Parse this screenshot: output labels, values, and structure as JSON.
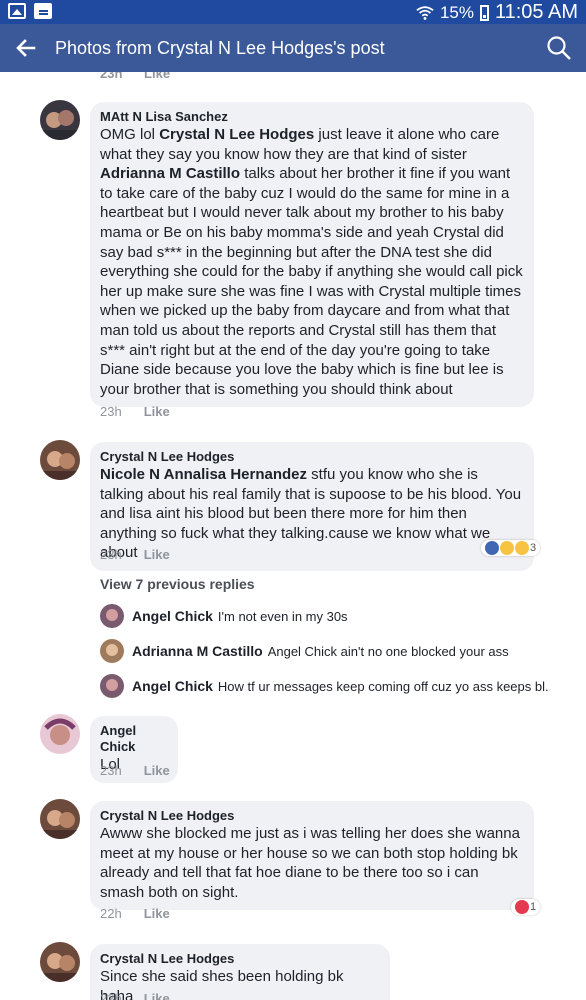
{
  "status_bar": {
    "battery": "15%",
    "time": "11:05 AM",
    "icons": [
      "image-icon",
      "message-icon",
      "wifi-icon",
      "battery-icon"
    ]
  },
  "appbar": {
    "title": "Photos from Crystal N Lee Hodges's post"
  },
  "top_partial": {
    "time": "23h",
    "like": "Like"
  },
  "comments": [
    {
      "author": "MAtt N Lisa Sanchez",
      "text_parts": [
        "OMG lol ",
        "Crystal N Lee Hodges",
        " just leave  it alone who care what they say you know how they are that kind of sister ",
        "Adrianna M Castillo",
        " talks about her  brother it fine if you want to take care of the baby cuz I would do the same for mine in a heartbeat but I would never talk about my brother to his baby mama or Be on his baby momma's side and yeah  Crystal did say bad s*** in the beginning but after the DNA test she did everything she could for the baby if anything she would call pick her up make sure she was fine I was with Crystal multiple times when we picked up the baby from daycare and from what that man told us about the reports and Crystal still has them that s*** ain't right but at the end of the day you're going to take Diane side because you love the baby which is fine but lee is your brother that is something you should think about"
      ],
      "time": "23h",
      "like": "Like"
    },
    {
      "author": "Crystal N Lee Hodges",
      "text_parts": [
        "Nicole N Annalisa Hernandez",
        " stfu you know who she is talking about his real family that is supoose to be his blood. You and lisa aint his blood but been there more for him then anything so fuck what they talking.cause we know what we about"
      ],
      "time": "23h",
      "like": "Like",
      "reactions": {
        "count": "3",
        "icons": [
          "like-icon",
          "haha-icon",
          "wow-icon"
        ]
      },
      "view_replies": "View 7 previous replies",
      "replies": [
        {
          "author": "Angel Chick",
          "text": "I'm not even in my 30s"
        },
        {
          "author": "Adrianna M Castillo",
          "text": "Angel Chick ain't no one blocked your ass"
        },
        {
          "author": "Angel Chick",
          "text": "How tf  ur messages keep  coming off cuz yo  ass keeps bl..."
        }
      ]
    },
    {
      "author": "Angel Chick",
      "text": "Lol",
      "time": "23h",
      "like": "Like"
    },
    {
      "author": "Crystal N Lee Hodges",
      "text": "Awww she blocked me just as i was telling her does she wanna meet at my house or her house so we can both stop holding bk already and tell that fat hoe diane to be there too so i can smash both on sight.",
      "time": "22h",
      "like": "Like",
      "reactions": {
        "count": "1",
        "icons": [
          "love-icon"
        ]
      }
    },
    {
      "author": "Crystal N Lee Hodges",
      "text": "Since she said shes been holding bk haha",
      "time": "22h",
      "like": "Like"
    }
  ],
  "colors": {
    "appbar": "#3b5998",
    "statusbar": "#1f4aa0",
    "bubble": "#f0f1f4",
    "meta": "#90949c"
  }
}
